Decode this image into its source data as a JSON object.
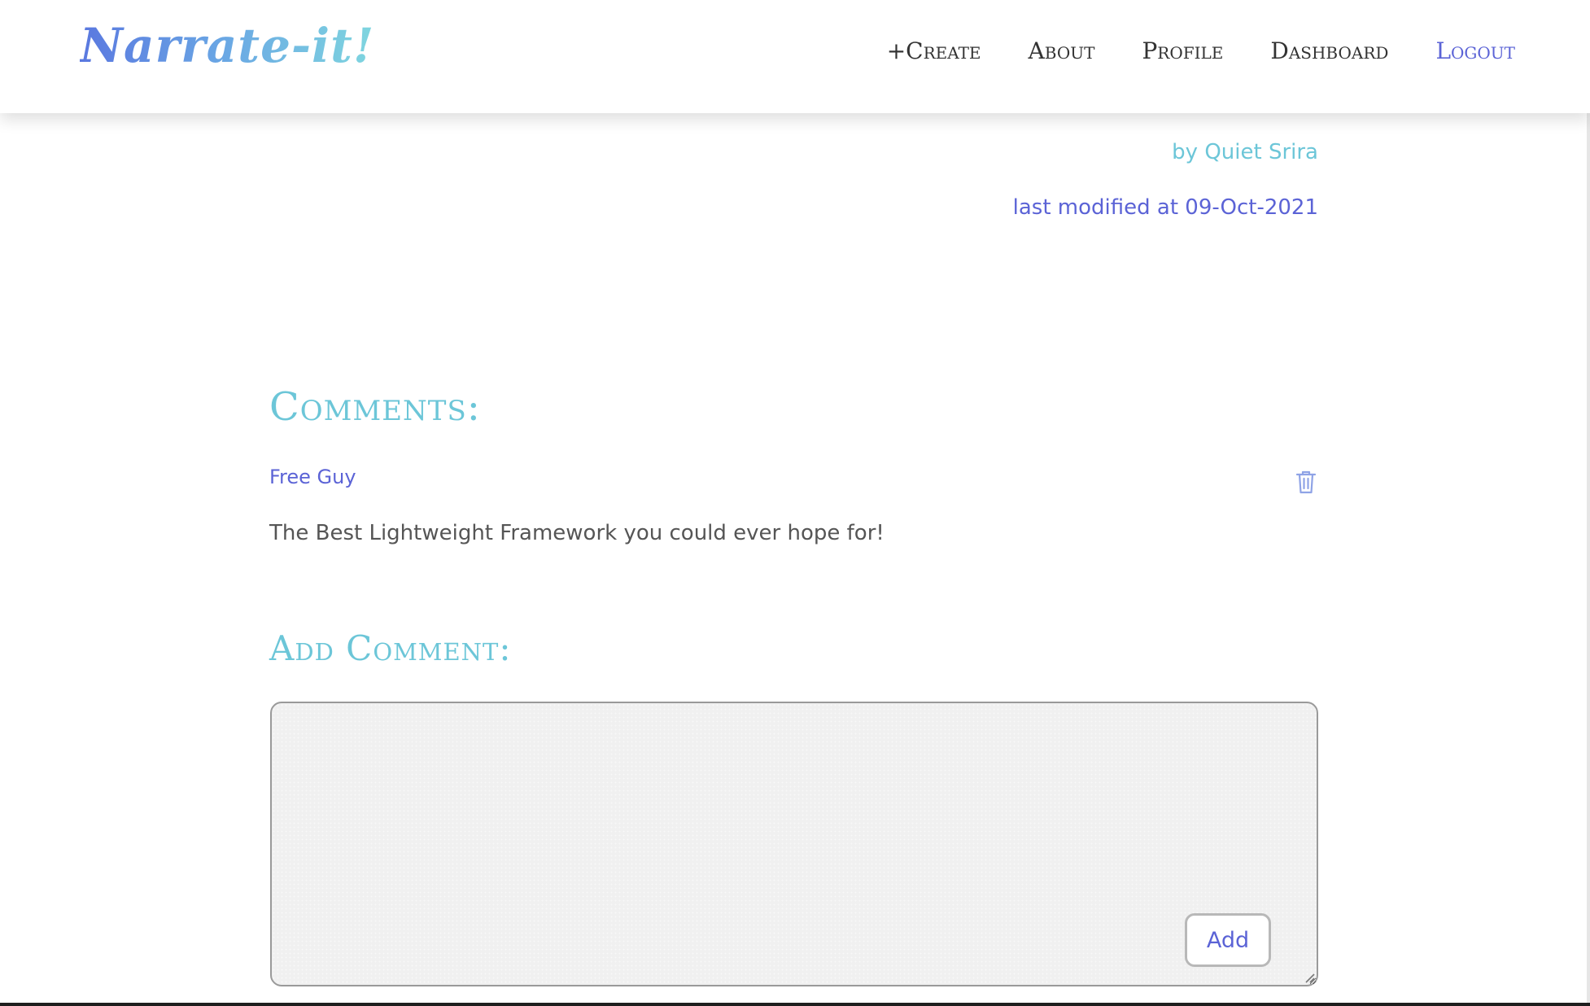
{
  "header": {
    "brand": "Narrate-it!",
    "nav": [
      {
        "label": "+Create"
      },
      {
        "label": "About"
      },
      {
        "label": "Profile"
      },
      {
        "label": "Dashboard"
      },
      {
        "label": "Logout"
      }
    ]
  },
  "post_meta": {
    "author": "by Quiet Srira",
    "modified": "last modified at 09-Oct-2021"
  },
  "comments": {
    "title": "Comments:",
    "items": [
      {
        "author": "Free Guy",
        "text": "The Best Lightweight Framework you could ever hope for!",
        "delete_icon": "trash-icon"
      }
    ]
  },
  "add_comment": {
    "title": "Add Comment:",
    "input_value": "",
    "button_label": "Add"
  },
  "colors": {
    "accent_blue": "#5b63d6",
    "accent_teal": "#6cc6d8",
    "text_dark": "#333333",
    "text_body": "#555555"
  }
}
